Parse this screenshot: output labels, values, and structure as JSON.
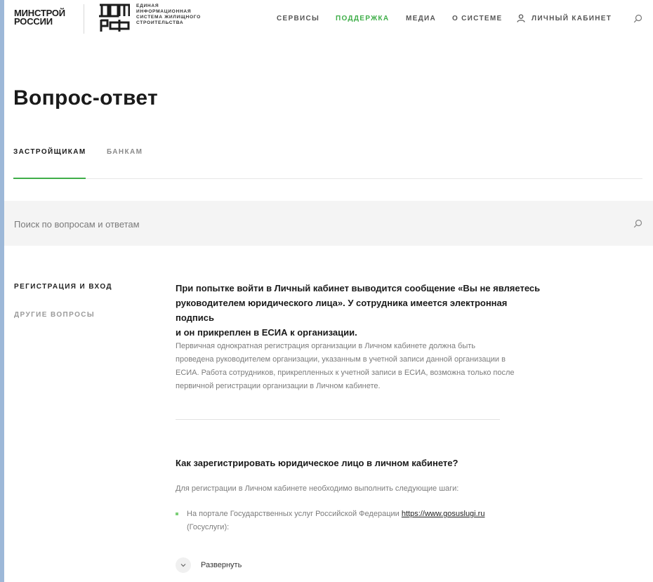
{
  "header": {
    "logo_minstroy": [
      "МИНСТРОЙ",
      "РОССИИ"
    ],
    "logo_dom_text": [
      "ЕДИНАЯ",
      "ИНФОРМАЦИОННАЯ",
      "СИСТЕМА ЖИЛИЩНОГО",
      "СТРОИТЕЛЬСТВА"
    ],
    "nav": {
      "services": "СЕРВИСЫ",
      "support": "ПОДДЕРЖКА",
      "media": "МЕДИА",
      "about": "О СИСТЕМЕ",
      "cabinet": "ЛИЧНЫЙ КАБИНЕТ"
    },
    "active_nav": "support"
  },
  "page": {
    "title": "Вопрос-ответ",
    "tabs": [
      {
        "label": "ЗАСТРОЙЩИКАМ",
        "active": true
      },
      {
        "label": "БАНКАМ",
        "active": false
      }
    ],
    "search": {
      "placeholder": "Поиск по вопросам и ответам",
      "value": ""
    }
  },
  "sidebar": {
    "categories": [
      {
        "label": "РЕГИСТРАЦИЯ И ВХОД",
        "active": true
      },
      {
        "label": "ДРУГИЕ ВОПРОСЫ",
        "active": false
      }
    ]
  },
  "faq": {
    "items": [
      {
        "question_lines": [
          "При попытке войти в Личный кабинет выводится сообщение «Вы не являетесь",
          "руководителем юридического лица». У сотрудника имеется электронная подпись",
          "и он прикреплен в ЕСИА к организации."
        ],
        "answer_lines": [
          "Первичная однократная регистрация организации в Личном кабинете должна быть",
          "проведена руководителем организации, указанным в учетной записи данной организации в",
          "ЕСИА. Работа сотрудников, прикрепленных к учетной записи в ЕСИА, возможна только после",
          "первичной регистрации организации в Личном кабинете."
        ]
      },
      {
        "question": "Как зарегистрировать юридическое лицо в личном кабинете?",
        "intro": "Для регистрации в Личном кабинете необходимо выполнить следующие шаги:",
        "bullet": {
          "text_before": "На портале Государственных услуг Российской Федерации ",
          "link": "https://www.gosuslugi.ru",
          "text_after": "(Госуслуги):"
        },
        "expand_label": "Развернуть"
      }
    ]
  },
  "colors": {
    "accent": "#3fae49",
    "bullet": "#7ccf78",
    "search_bg": "#f4f4f4"
  },
  "icons": {
    "top_search": "search-icon",
    "user": "user-icon",
    "search_bar": "search-icon",
    "expand": "chevron-down-icon"
  }
}
